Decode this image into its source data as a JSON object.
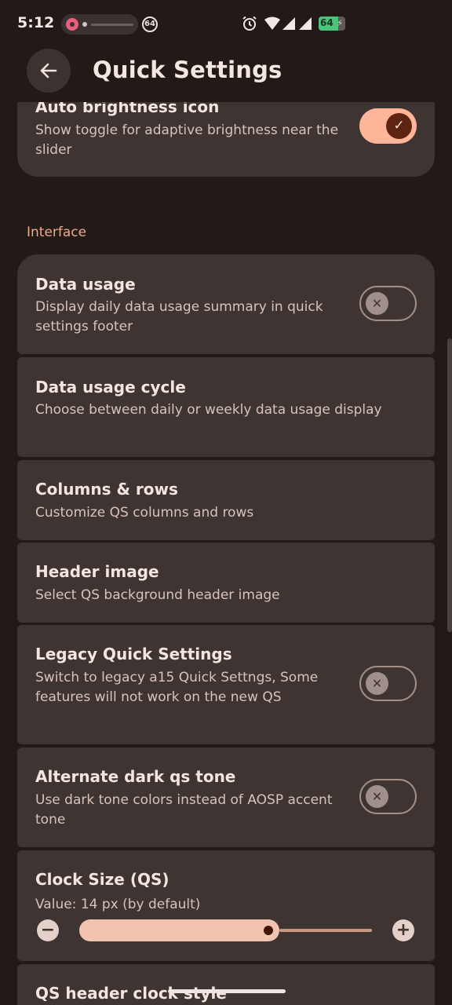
{
  "status_bar": {
    "time": "5:12",
    "notification_badge": "64",
    "battery_level": "64",
    "icons": [
      "instagram-icon",
      "alarm-icon",
      "wifi-icon",
      "signal-icon",
      "battery-charging-icon"
    ]
  },
  "app_bar": {
    "title": "Quick Settings",
    "back_icon": "arrow-left-icon"
  },
  "top_card": {
    "title": "Auto brightness icon",
    "subtitle": "Show toggle for adaptive brightness near the slider",
    "toggle": true
  },
  "section": {
    "label": "Interface"
  },
  "items": [
    {
      "title": "Data usage",
      "subtitle": "Display daily data usage summary in quick settings footer",
      "toggle": false
    },
    {
      "title": "Data usage cycle",
      "subtitle": "Choose between daily or weekly data usage display"
    },
    {
      "title": "Columns & rows",
      "subtitle": "Customize QS columns and rows"
    },
    {
      "title": "Header image",
      "subtitle": "Select QS background header image"
    },
    {
      "title": "Legacy Quick Settings",
      "subtitle": "Switch to legacy a15 Quick Settngs, Some features will not work on the new QS",
      "toggle": false
    },
    {
      "title": "Alternate dark qs tone",
      "subtitle": "Use dark tone colors instead of AOSP accent tone",
      "toggle": false
    }
  ],
  "clock_size": {
    "title": "Clock Size (QS)",
    "value_text": "Value: 14 px (by default)",
    "slider_fraction": 0.62
  },
  "partial_item": {
    "title": "QS header clock style"
  },
  "colors": {
    "background": "#211a17",
    "card": "#3e3532",
    "accent": "#ffb59a",
    "section_label": "#f0a98a"
  }
}
